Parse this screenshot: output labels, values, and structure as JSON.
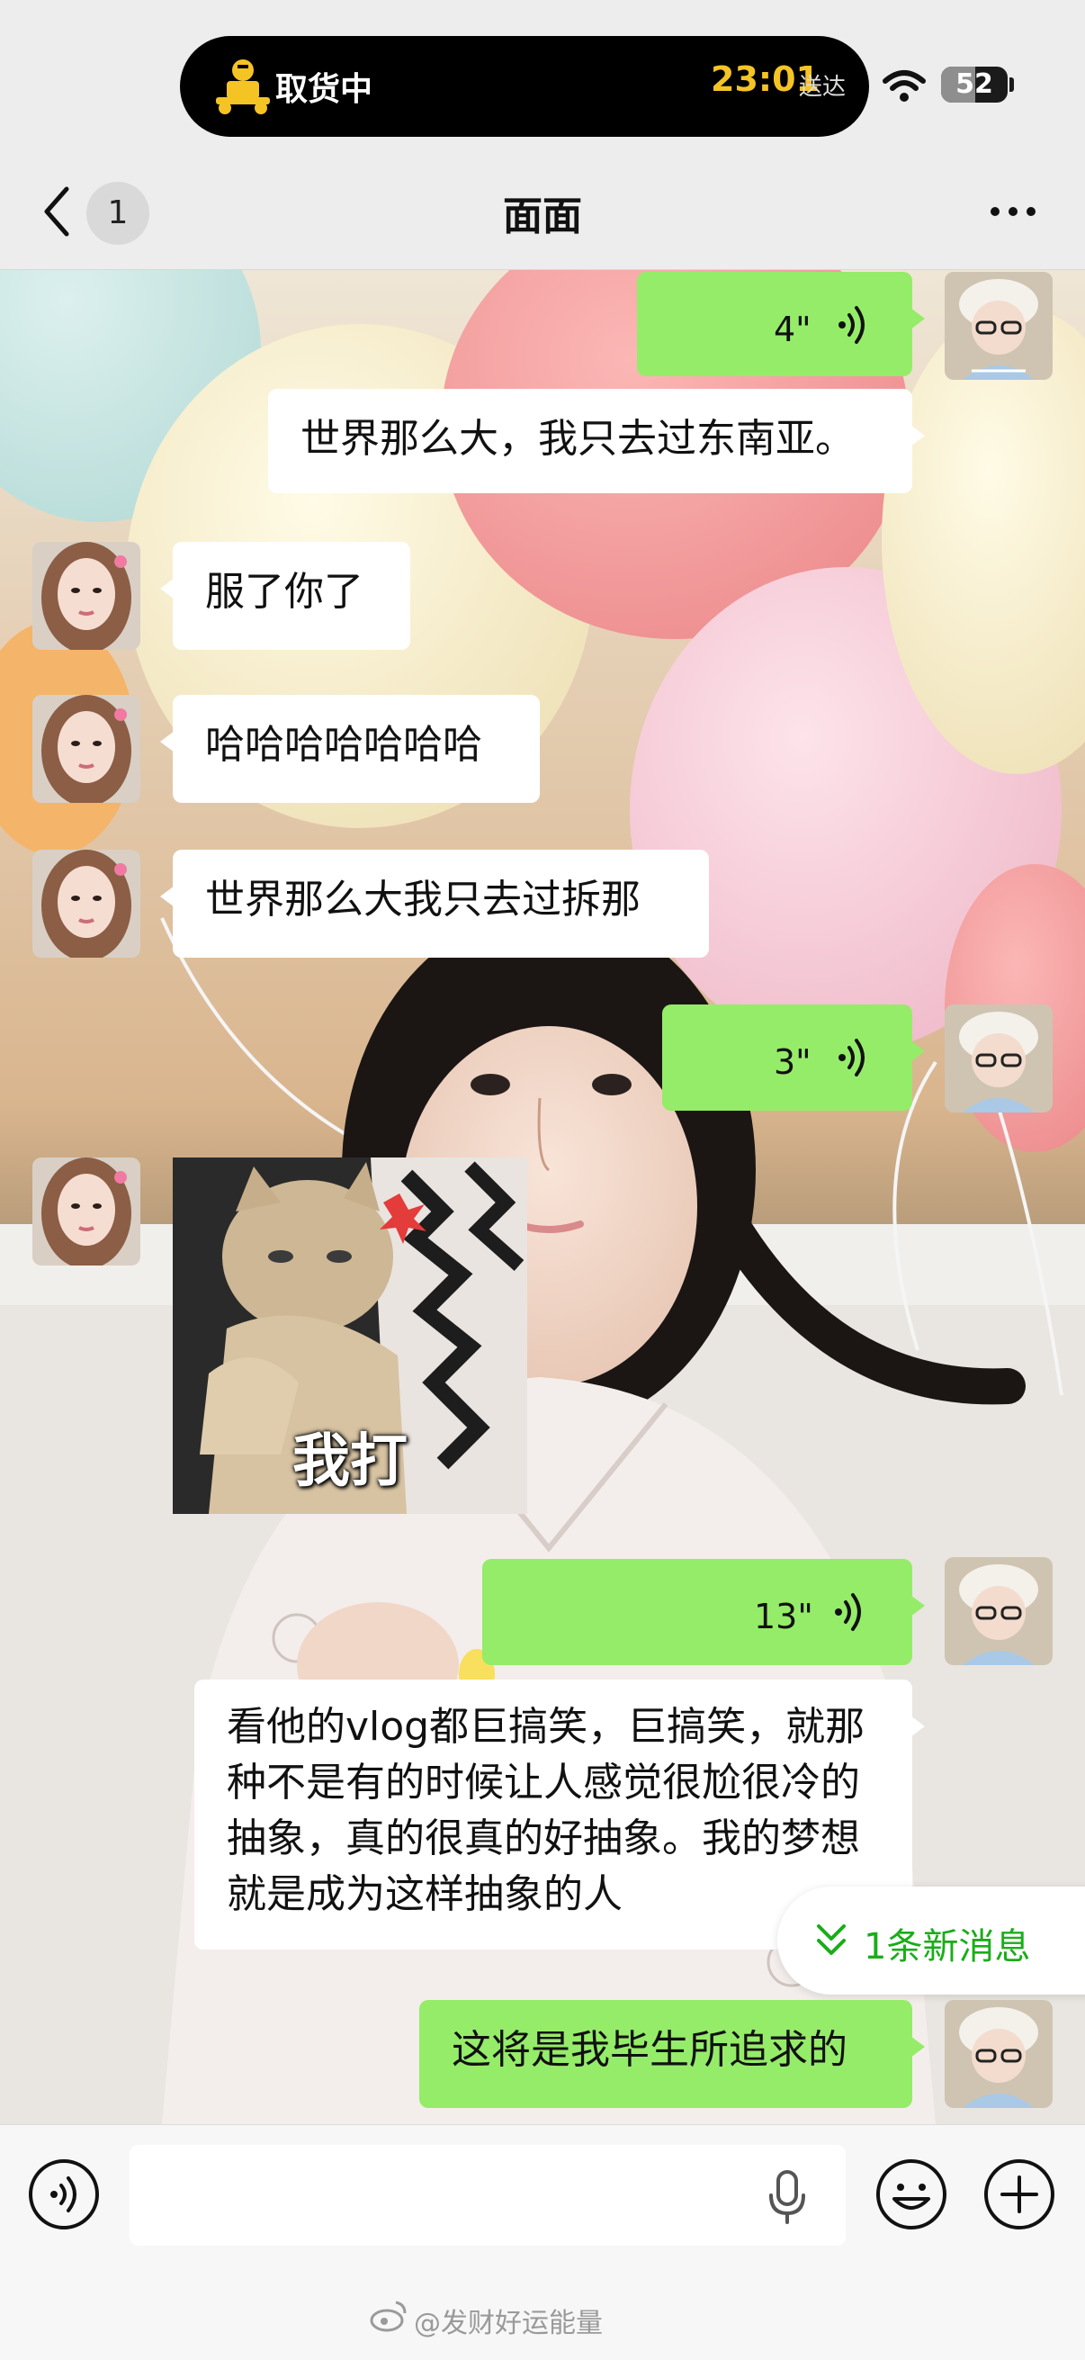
{
  "status_bar": {
    "activity_label": "取货中",
    "delivery_time": "23:01",
    "delivery_suffix": "送达",
    "battery": "52",
    "battery_level": 0.52
  },
  "nav": {
    "unread_count": "1",
    "title": "面面"
  },
  "messages": [
    {
      "side": "right",
      "type": "voice",
      "duration": "4\""
    },
    {
      "side": "right",
      "type": "text",
      "text": "世界那么大，我只去过东南亚。",
      "bubble": "white"
    },
    {
      "side": "left",
      "type": "text",
      "text": "服了你了"
    },
    {
      "side": "left",
      "type": "text",
      "text": "哈哈哈哈哈哈哈"
    },
    {
      "side": "left",
      "type": "text",
      "text": "世界那么大我只去过拆那"
    },
    {
      "side": "right",
      "type": "voice",
      "duration": "3\""
    },
    {
      "side": "left",
      "type": "sticker",
      "caption": "我打"
    },
    {
      "side": "right",
      "type": "voice",
      "duration": "13\""
    },
    {
      "side": "right",
      "type": "text",
      "text": "看他的vlog都巨搞笑，巨搞笑，就那种不是有的时候让人感觉很尬很冷的抽象，真的很真的好抽象。我的梦想就是成为这样抽象的人",
      "bubble": "white"
    },
    {
      "side": "right",
      "type": "text",
      "text": "这将是我毕生所追求的",
      "bubble": "green"
    }
  ],
  "new_message_pill": "1条新消息",
  "input": {
    "placeholder": ""
  },
  "watermark": "@发财好运能量",
  "colors": {
    "green_bubble": "#95ec69",
    "white_bubble": "#ffffff",
    "accent_green": "#1aad19",
    "island_time": "#f4c425"
  }
}
